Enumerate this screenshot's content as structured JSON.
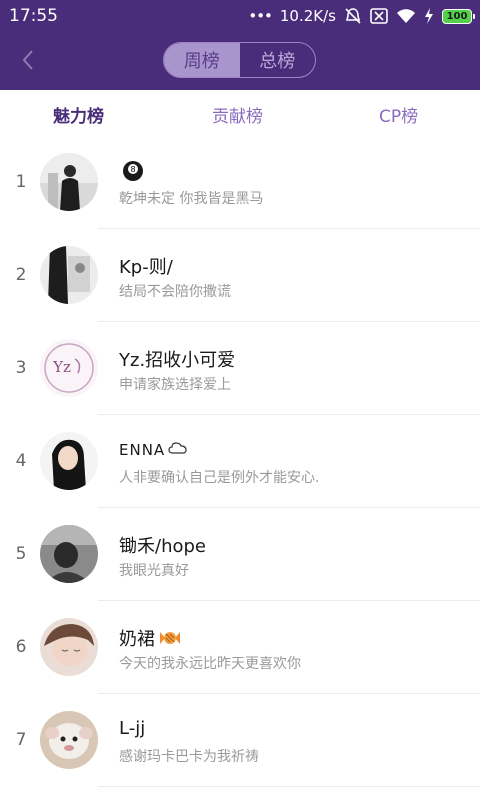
{
  "status_bar": {
    "time": "17:55",
    "network_speed": "10.2K/s",
    "battery": "100"
  },
  "header": {
    "toggle": [
      {
        "label": "周榜",
        "active": true
      },
      {
        "label": "总榜",
        "active": false
      }
    ]
  },
  "tabs": [
    {
      "label": "魅力榜",
      "active": true
    },
    {
      "label": "贡献榜",
      "active": false
    },
    {
      "label": "CP榜",
      "active": false
    }
  ],
  "ranking": [
    {
      "rank": "1",
      "name": "",
      "name_emoji": "8-ball",
      "signature": "乾坤未定  你我皆是黑马"
    },
    {
      "rank": "2",
      "name": "Kp-则/",
      "signature": "结局不会陪你撒谎"
    },
    {
      "rank": "3",
      "name": "Yz.招收小可爱",
      "signature": "申请家族选择爱上"
    },
    {
      "rank": "4",
      "name": "ENNA",
      "name_emoji": "cloud",
      "signature": "人非要确认自己是例外才能安心."
    },
    {
      "rank": "5",
      "name": "锄禾/hope",
      "signature": "我眼光真好"
    },
    {
      "rank": "6",
      "name": "奶裙",
      "name_emoji": "candy",
      "signature": "今天的我永远比昨天更喜欢你"
    },
    {
      "rank": "7",
      "name": "L-jj",
      "signature": "感谢玛卡巴卡为我祈祷"
    }
  ],
  "colors": {
    "header_bg": "#4a2d7a",
    "accent": "#8b6bbf"
  }
}
